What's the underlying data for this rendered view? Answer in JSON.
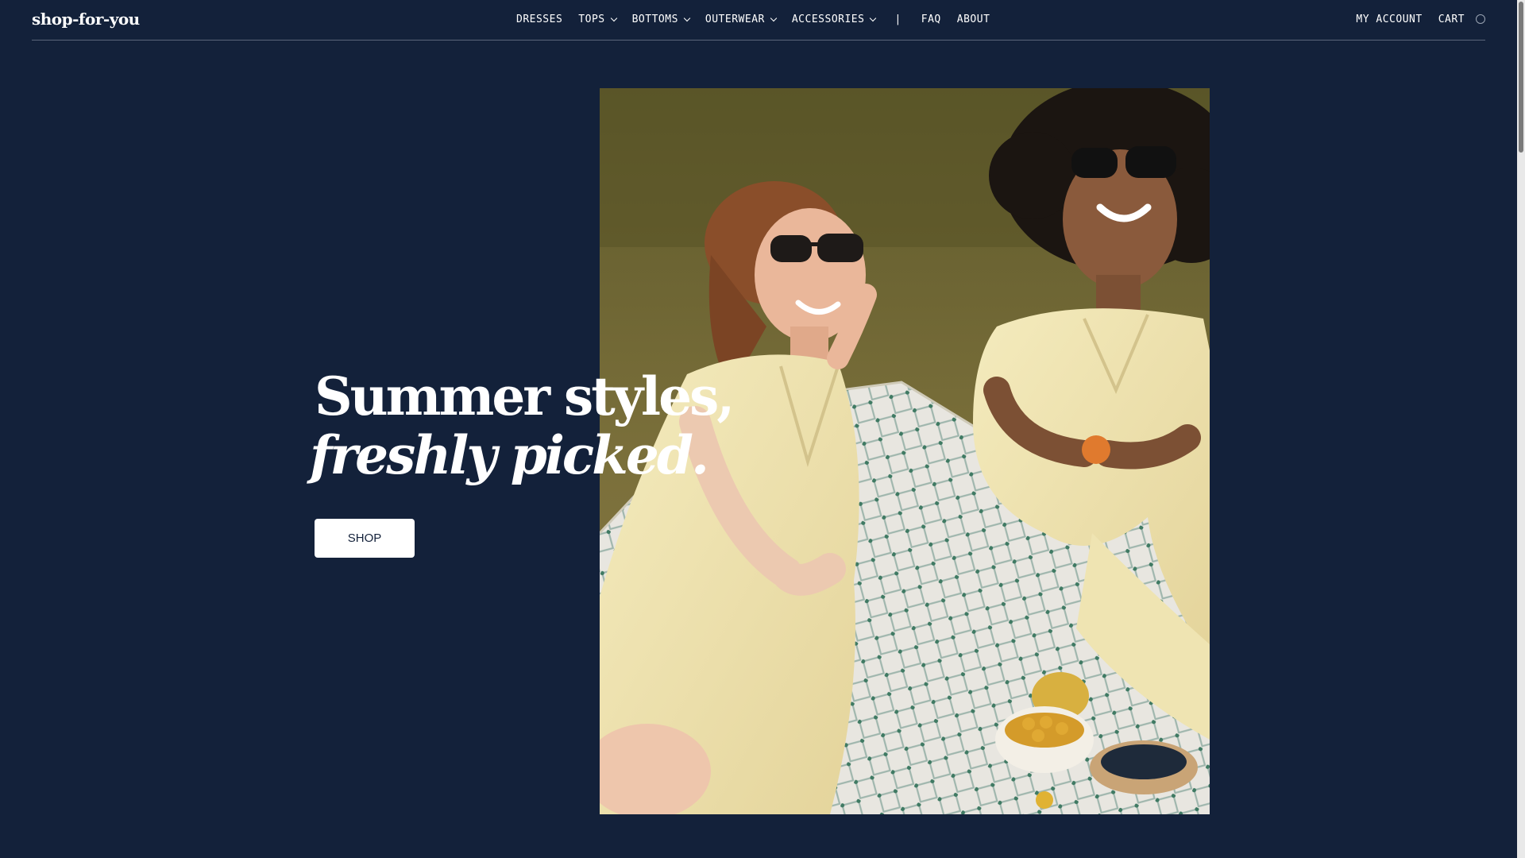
{
  "header": {
    "logo": "shop-for-you",
    "nav": [
      {
        "label": "DRESSES"
      },
      {
        "label": "TOPS"
      },
      {
        "label": "BOTTOMS"
      },
      {
        "label": "OUTERWEAR"
      },
      {
        "label": "ACCESSORIES"
      }
    ],
    "separator": "|",
    "secondary_nav": [
      {
        "label": "FAQ"
      },
      {
        "label": "ABOUT"
      }
    ],
    "account_label": "MY ACCOUNT",
    "cart_label": "CART"
  },
  "hero": {
    "headline_line1": "Summer styles,",
    "headline_line2": "freshly picked.",
    "cta_label": "SHOP"
  },
  "colors": {
    "background": "#13213a",
    "text": "#ffffff",
    "button_bg": "#ffffff",
    "button_text": "#13213a"
  },
  "icons": {
    "dropdown": "chevron-down-icon",
    "cart": "cart-circle-icon"
  }
}
